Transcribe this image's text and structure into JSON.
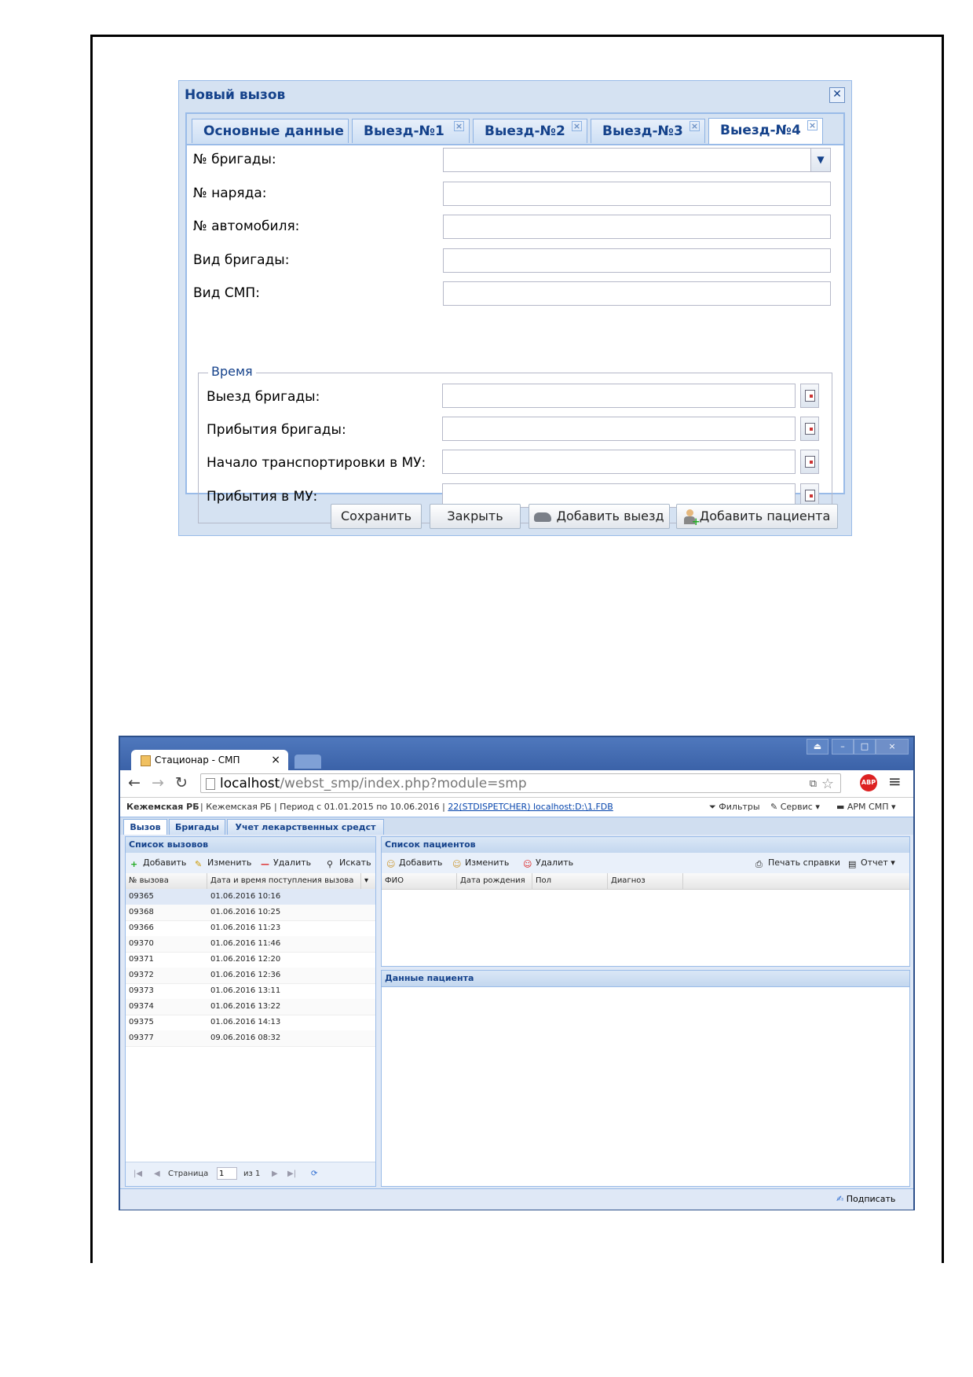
{
  "dialog": {
    "title": "Новый вызов",
    "close_glyph": "✕",
    "tabs": [
      {
        "label": "Основные данные",
        "closable": false,
        "active": false
      },
      {
        "label": "Выезд-№1",
        "closable": true,
        "active": false
      },
      {
        "label": "Выезд-№2",
        "closable": true,
        "active": false
      },
      {
        "label": "Выезд-№3",
        "closable": true,
        "active": false
      },
      {
        "label": "Выезд-№4",
        "closable": true,
        "active": true
      }
    ],
    "fields": {
      "brigade_no": {
        "label": "№ бригады:",
        "value": ""
      },
      "order_no": {
        "label": "№ наряда:",
        "value": ""
      },
      "car_no": {
        "label": "№ автомобиля:",
        "value": ""
      },
      "brigade_type": {
        "label": "Вид бригады:",
        "value": ""
      },
      "smp_type": {
        "label": "Вид СМП:",
        "value": ""
      }
    },
    "time_group": {
      "legend": "Время",
      "departure": {
        "label": "Выезд бригады:",
        "value": ""
      },
      "arrival": {
        "label": "Прибытия бригады:",
        "value": ""
      },
      "transport_start": {
        "label": "Начало транспортировки в МУ:",
        "value": ""
      },
      "arrival_mu": {
        "label": "Прибытия в МУ:",
        "value": ""
      }
    },
    "buttons": {
      "save": "Сохранить",
      "close": "Закрыть",
      "add_departure": "Добавить выезд",
      "add_patient": "Добавить пациента"
    }
  },
  "browser": {
    "tab_title": "Стационар - СМП",
    "tab_close": "×",
    "window_controls": [
      "⏏",
      "–",
      "□",
      "×"
    ],
    "url_host": "localhost",
    "url_rest": "/webst_smp/index.php?module=smp",
    "abp_label": "ABP"
  },
  "app": {
    "org": "Кежемская РБ",
    "info": "| Кежемская РБ | Период с 01.01.2015 по 10.06.2016 |",
    "user_link": "22(STDISPETCHER) localhost:D:\\1.FDB",
    "menu": {
      "filters": "Фильтры",
      "service": "Сервис ▾",
      "arm": "АРМ СМП ▾"
    },
    "tabs": [
      "Вызов",
      "Бригады",
      "Учет лекарственных средст"
    ],
    "calls_panel": {
      "title": "Список вызовов",
      "toolbar": {
        "add": "Добавить",
        "edit": "Изменить",
        "delete": "Удалить",
        "search": "Искать"
      },
      "columns": [
        "№ вызова",
        "Дата и время поступления вызова"
      ],
      "rows": [
        {
          "no": "09365",
          "dt": "01.06.2016 10:16"
        },
        {
          "no": "09368",
          "dt": "01.06.2016 10:25"
        },
        {
          "no": "09366",
          "dt": "01.06.2016 11:23"
        },
        {
          "no": "09370",
          "dt": "01.06.2016 11:46"
        },
        {
          "no": "09371",
          "dt": "01.06.2016 12:20"
        },
        {
          "no": "09372",
          "dt": "01.06.2016 12:36"
        },
        {
          "no": "09373",
          "dt": "01.06.2016 13:11"
        },
        {
          "no": "09374",
          "dt": "01.06.2016 13:22"
        },
        {
          "no": "09375",
          "dt": "01.06.2016 14:13"
        },
        {
          "no": "09377",
          "dt": "09.06.2016 08:32"
        }
      ],
      "pager": {
        "page_label": "Страница",
        "page": "1",
        "of": "из 1"
      }
    },
    "patients_panel": {
      "title": "Список пациентов",
      "toolbar": {
        "add": "Добавить",
        "edit": "Изменить",
        "delete": "Удалить",
        "print": "Печать справки",
        "report": "Отчет ▾"
      },
      "columns": [
        "ФИО",
        "Дата рождения",
        "Пол",
        "Диагноз"
      ]
    },
    "patient_data_panel": {
      "title": "Данные пациента"
    },
    "status": {
      "sign": "Подписать"
    }
  }
}
